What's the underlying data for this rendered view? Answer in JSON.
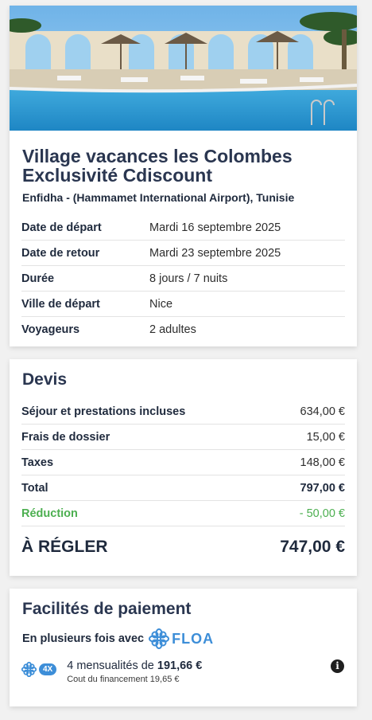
{
  "trip": {
    "title_line1": "Village vacances les Colombes",
    "title_line2": "Exclusivité Cdiscount",
    "location": "Enfidha - (Hammamet International Airport), Tunisie",
    "details": [
      {
        "label": "Date de départ",
        "value": "Mardi 16 septembre 2025"
      },
      {
        "label": "Date de retour",
        "value": "Mardi 23 septembre 2025"
      },
      {
        "label": "Durée",
        "value": "8 jours / 7 nuits"
      },
      {
        "label": "Ville de départ",
        "value": "Nice"
      },
      {
        "label": "Voyageurs",
        "value": "2 adultes"
      }
    ]
  },
  "devis": {
    "title": "Devis",
    "lines": [
      {
        "label": "Séjour et prestations incluses",
        "value": "634,00 €"
      },
      {
        "label": "Frais de dossier",
        "value": "15,00 €"
      },
      {
        "label": "Taxes",
        "value": "148,00 €"
      },
      {
        "label": "Total",
        "value": "797,00 €"
      },
      {
        "label": "Réduction",
        "value": "- 50,00 €"
      }
    ],
    "pay_label": "À RÉGLER",
    "pay_value": "747,00 €",
    "reduction_color": "#4caf50"
  },
  "facilites": {
    "title": "Facilités de paiement",
    "subtitle": "En plusieurs fois avec",
    "brand": "FLOA",
    "badge": "4X",
    "offer_prefix": "4 mensualités de ",
    "offer_amount": "191,66 €",
    "offer_cost": "Cout du financement 19,65 €",
    "brand_color": "#3d8ed8"
  }
}
